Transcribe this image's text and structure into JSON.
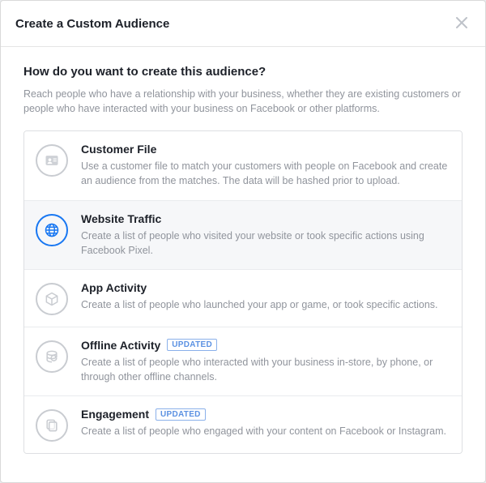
{
  "modal": {
    "title": "Create a Custom Audience",
    "question": "How do you want to create this audience?",
    "explainer": "Reach people who have a relationship with your business, whether they are existing customers or people who have interacted with your business on Facebook or other platforms."
  },
  "badge_label": "UPDATED",
  "options": [
    {
      "id": "customer-file",
      "icon": "contact-card-icon",
      "title": "Customer File",
      "desc": "Use a customer file to match your customers with people on Facebook and create an audience from the matches. The data will be hashed prior to upload.",
      "badge": false,
      "selected": false
    },
    {
      "id": "website-traffic",
      "icon": "globe-icon",
      "title": "Website Traffic",
      "desc": "Create a list of people who visited your website or took specific actions using Facebook Pixel.",
      "badge": false,
      "selected": true
    },
    {
      "id": "app-activity",
      "icon": "cube-icon",
      "title": "App Activity",
      "desc": "Create a list of people who launched your app or game, or took specific actions.",
      "badge": false,
      "selected": false
    },
    {
      "id": "offline-activity",
      "icon": "stack-refresh-icon",
      "title": "Offline Activity",
      "desc": "Create a list of people who interacted with your business in-store, by phone, or through other offline channels.",
      "badge": true,
      "selected": false
    },
    {
      "id": "engagement",
      "icon": "pages-icon",
      "title": "Engagement",
      "desc": "Create a list of people who engaged with your content on Facebook or Instagram.",
      "badge": true,
      "selected": false
    }
  ]
}
